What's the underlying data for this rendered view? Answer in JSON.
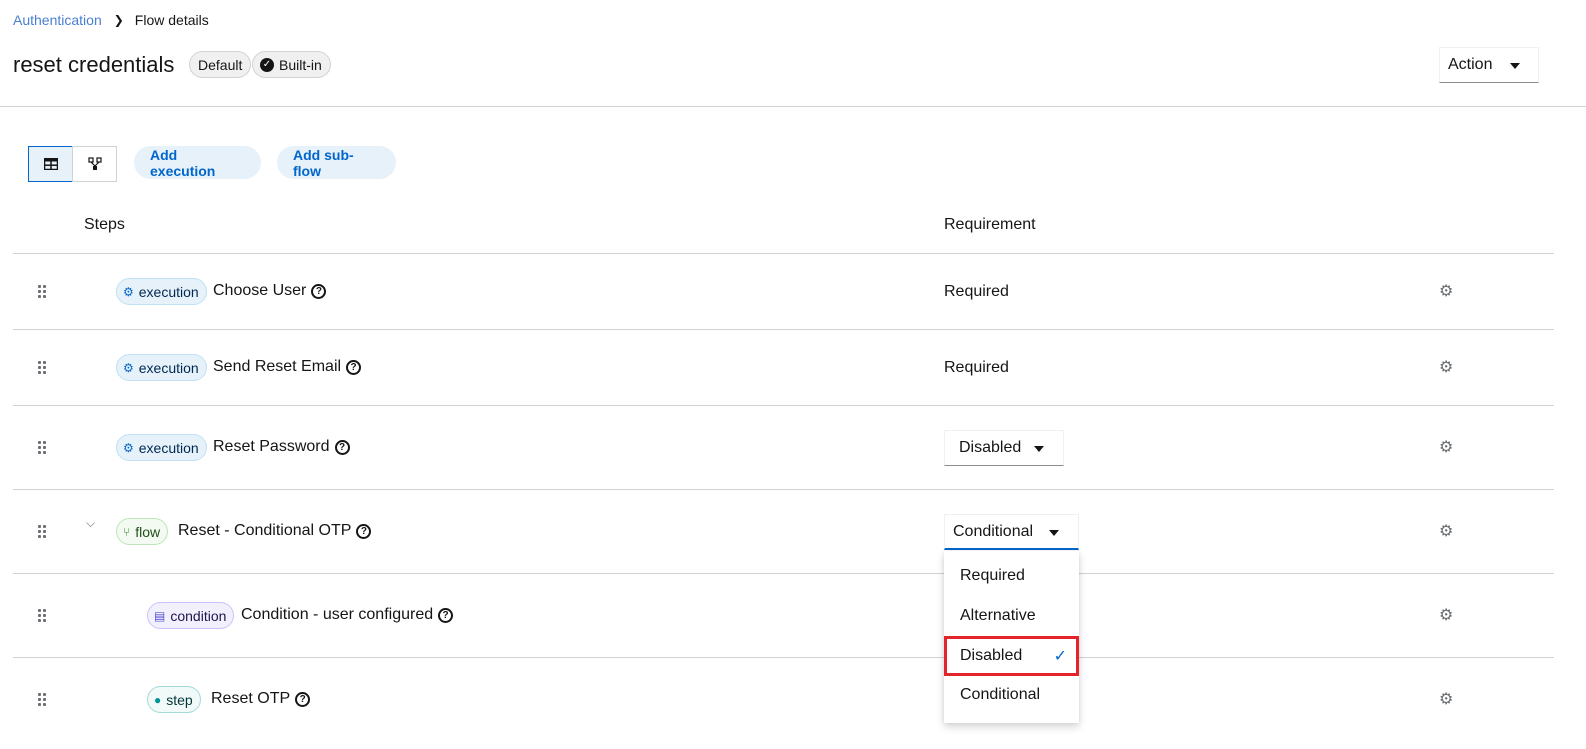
{
  "breadcrumb": {
    "parent": "Authentication",
    "current": "Flow details"
  },
  "header": {
    "title": "reset credentials",
    "badge_default": "Default",
    "badge_builtin": "Built-in",
    "action_label": "Action"
  },
  "toolbar": {
    "add_execution": "Add execution",
    "add_subflow": "Add sub-flow"
  },
  "table": {
    "headers": {
      "steps": "Steps",
      "requirement": "Requirement"
    },
    "rows": [
      {
        "tag": "execution",
        "name": "Choose User",
        "requirement": "Required"
      },
      {
        "tag": "execution",
        "name": "Send Reset Email",
        "requirement": "Required"
      },
      {
        "tag": "execution",
        "name": "Reset Password",
        "requirement": "Disabled"
      },
      {
        "tag": "flow",
        "name": "Reset - Conditional OTP",
        "requirement": "Conditional"
      },
      {
        "tag": "condition",
        "name": "Condition - user configured",
        "requirement": ""
      },
      {
        "tag": "step",
        "name": "Reset OTP",
        "requirement": ""
      }
    ]
  },
  "dropdown": {
    "options": [
      "Required",
      "Alternative",
      "Disabled",
      "Conditional"
    ],
    "selected": "Disabled"
  },
  "colors": {
    "accent": "#0066cc",
    "highlight": "#e3242b"
  }
}
